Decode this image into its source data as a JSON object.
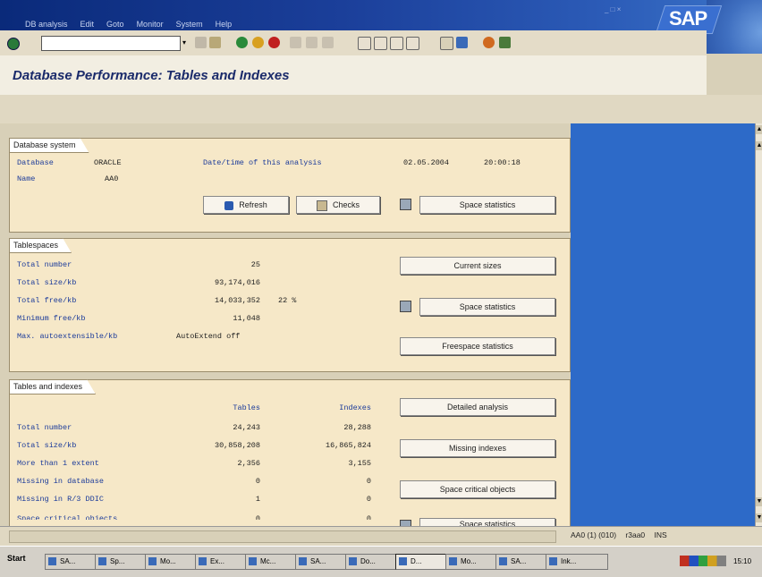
{
  "menu": [
    "DB analysis",
    "Edit",
    "Goto",
    "Monitor",
    "System",
    "Help"
  ],
  "window_controls": "_ □ ×",
  "brand": "SAP",
  "page_title": "Database Performance: Tables and Indexes",
  "db_system": {
    "title": "Database system",
    "database_label": "Database",
    "database_value": "ORACLE",
    "name_label": "Name",
    "name_value": "AA0",
    "analysis_label": "Date/time of this analysis",
    "analysis_date": "02.05.2004",
    "analysis_time": "20:00:18",
    "refresh_btn": "Refresh",
    "checks_btn": "Checks",
    "space_btn": "Space statistics"
  },
  "tablespaces": {
    "title": "Tablespaces",
    "rows": [
      {
        "label": "Total number",
        "value": "25",
        "extra": ""
      },
      {
        "label": "Total size/kb",
        "value": "93,174,016",
        "extra": ""
      },
      {
        "label": "Total free/kb",
        "value": "14,033,352",
        "extra": "22 %"
      },
      {
        "label": "Minimum free/kb",
        "value": "11,048",
        "extra": ""
      },
      {
        "label": "Max. autoextensible/kb",
        "value": "AutoExtend off",
        "extra": ""
      }
    ],
    "current_btn": "Current sizes",
    "space_btn": "Space statistics",
    "free_btn": "Freespace statistics"
  },
  "tables": {
    "title": "Tables and indexes",
    "col_tables": "Tables",
    "col_indexes": "Indexes",
    "rows": [
      {
        "label": "Total number",
        "tables": "24,243",
        "indexes": "28,288"
      },
      {
        "label": "Total size/kb",
        "tables": "30,858,208",
        "indexes": "16,865,824"
      },
      {
        "label": "More than 1 extent",
        "tables": "2,356",
        "indexes": "3,155"
      },
      {
        "label": "Missing in database",
        "tables": "0",
        "indexes": "0"
      },
      {
        "label": "Missing in R/3 DDIC",
        "tables": "1",
        "indexes": "0"
      },
      {
        "label": "Space critical objects",
        "tables": "0",
        "indexes": "0"
      }
    ],
    "detailed_btn": "Detailed analysis",
    "missing_btn": "Missing indexes",
    "critical_btn": "Space critical objects",
    "space_btn": "Space statistics"
  },
  "status": {
    "system": "AA0 (1) (010)",
    "server": "r3aa0",
    "mode": "INS"
  },
  "taskbar": {
    "start": "Start",
    "tasks": [
      "SA...",
      "Sp...",
      "Mo...",
      "Ex...",
      "Mc...",
      "SA...",
      "Do...",
      "D...",
      "Mo...",
      "SA...",
      "Ink..."
    ],
    "clock": "15:10"
  },
  "colors": {
    "accent": "#1a3a9a",
    "panel": "#f6e8c8",
    "desktop": "#2d6ac8"
  }
}
